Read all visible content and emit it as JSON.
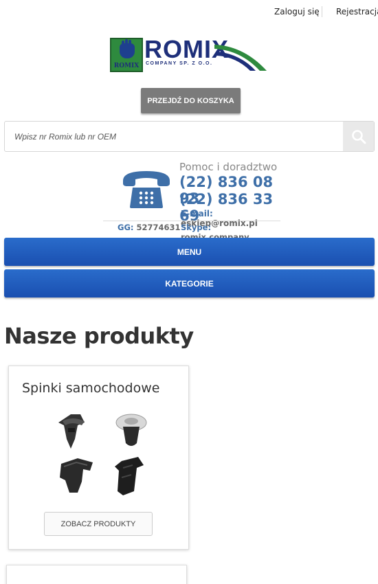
{
  "header": {
    "login_label": "Zaloguj się",
    "register_label": "Rejestracja"
  },
  "logo": {
    "mini_text": "ROMIX",
    "word": "ROMIX",
    "subtitle": "COMPANY SP. Z O.O."
  },
  "cart": {
    "button_label": "PRZEJDŹ DO KOSZYKA"
  },
  "search": {
    "placeholder": "Wpisz nr Romix lub nr OEM",
    "icon": "search-icon"
  },
  "contact": {
    "help_label": "Pomoc i doradztwo",
    "phone_1": "(22) 836 08 93",
    "phone_2": "(22) 836 33 69",
    "email_label": "E-mail:",
    "email_value": "esklep@romix.pl",
    "gg_label": "GG:",
    "gg_value": "52774631",
    "skype_label": "Skype:",
    "skype_value": "romix.company"
  },
  "nav": {
    "menu_label": "MENU",
    "categories_label": "KATEGORIE"
  },
  "products": {
    "section_title": "Nasze produkty",
    "cards": [
      {
        "title": "Spinki samochodowe",
        "button_label": "ZOBACZ PRODUKTY"
      }
    ]
  },
  "colors": {
    "accent_blue": "#2a6ccb",
    "contact_blue": "#3e6fa8",
    "cart_gray": "#7b7b7b",
    "logo_green": "#2e8a3e",
    "logo_navy": "#1e2f7a"
  }
}
